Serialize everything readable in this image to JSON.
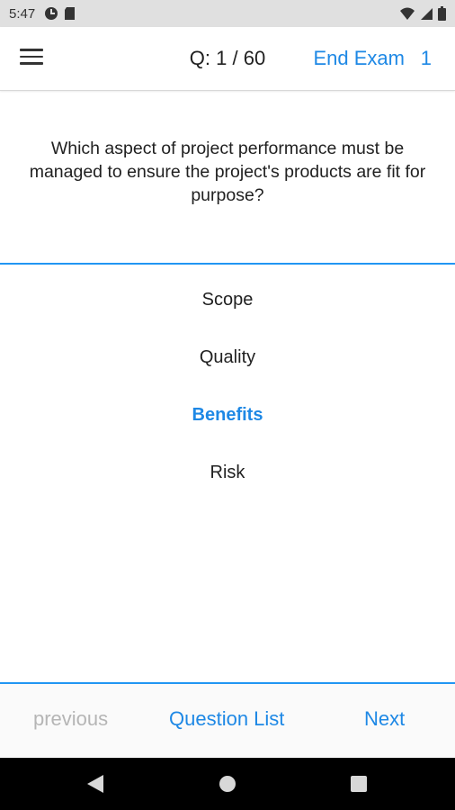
{
  "status_bar": {
    "time": "5:47",
    "icons_left": [
      "app-notification-icon",
      "sd-card-icon"
    ],
    "icons_right": [
      "wifi-icon",
      "signal-icon",
      "battery-icon"
    ]
  },
  "header": {
    "question_counter": "Q: 1 / 60",
    "end_exam_label": "End Exam",
    "end_exam_count": "1"
  },
  "question": {
    "text": "Which aspect of project performance must be managed to ensure the project's products are fit for purpose?"
  },
  "options": [
    {
      "label": "Scope",
      "selected": false
    },
    {
      "label": "Quality",
      "selected": false
    },
    {
      "label": "Benefits",
      "selected": true
    },
    {
      "label": "Risk",
      "selected": false
    }
  ],
  "footer": {
    "previous_label": "previous",
    "question_list_label": "Question List",
    "next_label": "Next"
  },
  "colors": {
    "accent": "#1e88e5",
    "divider": "#2196f3",
    "disabled": "#b5b5b5",
    "text": "#212121"
  }
}
